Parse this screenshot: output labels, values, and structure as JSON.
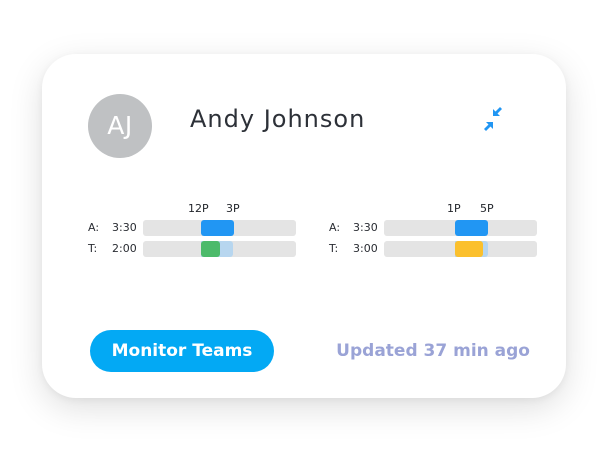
{
  "user": {
    "initials": "AJ",
    "name": "Andy Johnson"
  },
  "icons": {
    "collapse": "collapse-arrows-icon"
  },
  "colors": {
    "actual": "#2196f3",
    "actual_light": "#b7d6ef",
    "on_track": "#4cba6a",
    "warning": "#fbc02d",
    "track": "#e4e4e4",
    "button": "#03a9f4",
    "updated_text": "#9aa3d6"
  },
  "panels": [
    {
      "ticks": [
        "12P",
        "3P"
      ],
      "rows": [
        {
          "label": "A:",
          "duration": "3:30"
        },
        {
          "label": "T:",
          "duration": "2:00"
        }
      ]
    },
    {
      "ticks": [
        "1P",
        "5P"
      ],
      "rows": [
        {
          "label": "A:",
          "duration": "3:30"
        },
        {
          "label": "T:",
          "duration": "3:00"
        }
      ]
    }
  ],
  "footer": {
    "monitor_label": "Monitor Teams",
    "updated_text": "Updated 37 min ago"
  }
}
